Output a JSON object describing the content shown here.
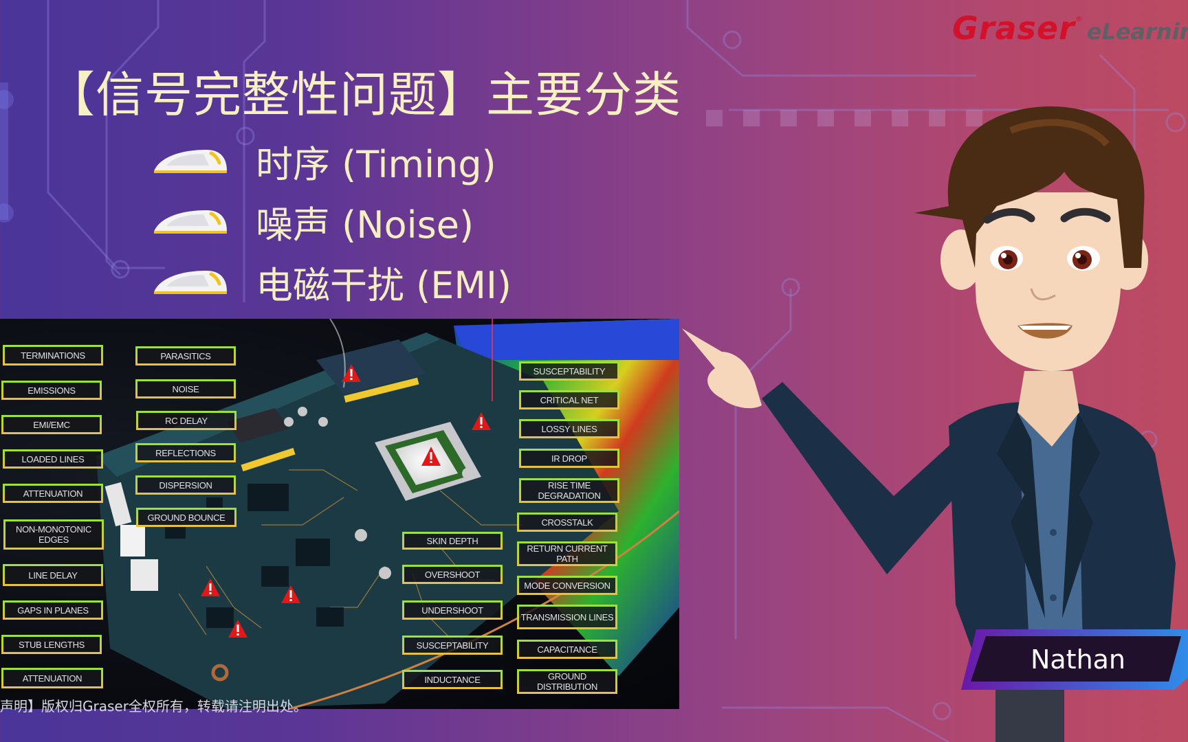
{
  "logo": {
    "brand": "Graser",
    "registered": "®",
    "suffix": "eLearnin"
  },
  "slide": {
    "title": "【信号完整性问题】主要分类",
    "bullets": [
      {
        "icon": "mouse-icon",
        "text": "时序 (Timing)"
      },
      {
        "icon": "mouse-icon",
        "text": "噪声 (Noise)"
      },
      {
        "icon": "mouse-icon",
        "text": "电磁干扰 (EMI)"
      }
    ]
  },
  "image_labels": {
    "col1": [
      "TERMINATIONS",
      "EMISSIONS",
      "EMI/EMC",
      "LOADED LINES",
      "ATTENUATION",
      "NON-MONOTONIC EDGES",
      "LINE DELAY",
      "GAPS IN PLANES",
      "STUB LENGTHS",
      "ATTENUATION"
    ],
    "col2": [
      "PARASITICS",
      "NOISE",
      "RC DELAY",
      "REFLECTIONS",
      "DISPERSION",
      "GROUND BOUNCE"
    ],
    "col3": [
      "SKIN DEPTH",
      "OVERSHOOT",
      "UNDERSHOOT",
      "SUSCEPTABILITY",
      "INDUCTANCE"
    ],
    "col4": [
      "SUSCEPTABILITY",
      "CRITICAL NET",
      "LOSSY LINES",
      "IR DROP",
      "RISE TIME DEGRADATION",
      "CROSSTALK",
      "RETURN CURRENT PATH",
      "MODE CONVERSION",
      "TRANSMISSION LINES",
      "CAPACITANCE",
      "GROUND DISTRIBUTION"
    ]
  },
  "copyright": "声明】版权归Graser全权所有，转载请注明出处。",
  "presenter": {
    "name": "Nathan"
  },
  "colors": {
    "title": "#f6f0c4",
    "brand_red": "#d3112a",
    "tag_border_top": "#9be23a",
    "tag_border_bottom": "#e9c23a"
  }
}
